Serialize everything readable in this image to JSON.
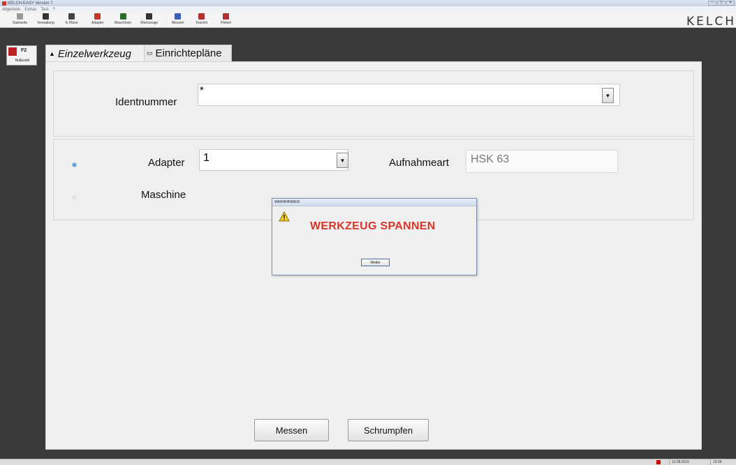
{
  "window": {
    "title": "KELCH-EASY Version 7"
  },
  "menu": [
    "Allgemein",
    "Extras",
    "Test",
    "?"
  ],
  "toolbar": [
    {
      "label": "Startseite",
      "icon": "home-icon",
      "color": "#8c8c8c"
    },
    {
      "label": "Verwaltung",
      "icon": "admin-icon",
      "color": "#333333"
    },
    {
      "label": "E.Pläne",
      "icon": "plans-icon",
      "color": "#444444"
    },
    {
      "label": "Adapter",
      "icon": "adapter-icon",
      "color": "#c0392b"
    },
    {
      "label": "Maschinen",
      "icon": "machine-icon",
      "color": "#2e6b2e"
    },
    {
      "label": "Werkzeuge",
      "icon": "tool-icon",
      "color": "#333333"
    },
    {
      "label": "Messen",
      "icon": "measure-icon",
      "color": "#3a5fb0"
    },
    {
      "label": "Teachin",
      "icon": "teachin-icon",
      "color": "#b03030"
    },
    {
      "label": "Plinkel",
      "icon": "plinkel-icon",
      "color": "#b03030"
    }
  ],
  "brand": "KELCH",
  "left_panel": {
    "key": "F2",
    "label": "Nullpunkt"
  },
  "tabs": [
    {
      "label": "Einzelwerkzeug",
      "icon": "▲",
      "active": true
    },
    {
      "label": "Einrichtepläne",
      "icon": "▭",
      "active": false
    }
  ],
  "form": {
    "ident_label": "Identnummer",
    "ident_value": "*",
    "adapter_label": "Adapter",
    "adapter_value": "1",
    "aufnahme_label": "Aufnahmeart",
    "aufnahme_value": "HSK 63",
    "maschine_label": "Maschine"
  },
  "buttons": {
    "messen": "Messen",
    "schrumpfen": "Schrumpfen"
  },
  "dialog": {
    "title": "WARNHINWEIS",
    "message": "WERKZEUG SPANNEN",
    "button": "Weiter"
  },
  "status": {
    "date": "13.08.2015",
    "time": "15:06"
  },
  "colors": {
    "warning_text": "#d8352a",
    "radio_selected": "#5aa0d8"
  }
}
